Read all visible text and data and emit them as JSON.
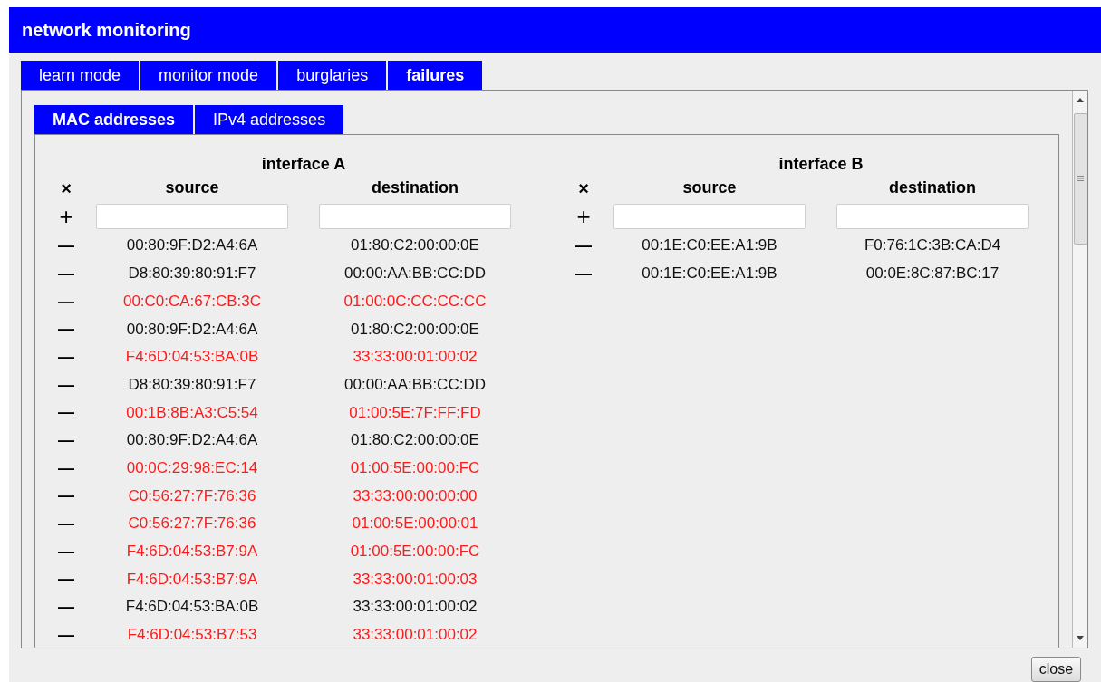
{
  "window": {
    "title": "network monitoring"
  },
  "tabs": [
    {
      "label": "learn mode",
      "selected": false
    },
    {
      "label": "monitor mode",
      "selected": false
    },
    {
      "label": "burglaries",
      "selected": false
    },
    {
      "label": "failures",
      "selected": true
    }
  ],
  "subtabs": [
    {
      "label": "MAC addresses",
      "selected": true
    },
    {
      "label": "IPv4 addresses",
      "selected": false
    }
  ],
  "interfaces": [
    {
      "title": "interface A",
      "clear": "×",
      "add": "+",
      "columns": [
        "source",
        "destination"
      ],
      "rows": [
        {
          "remove": "—",
          "source": "00:80:9F:D2:A4:6A",
          "destination": "01:80:C2:00:00:0E",
          "failed": false
        },
        {
          "remove": "—",
          "source": "D8:80:39:80:91:F7",
          "destination": "00:00:AA:BB:CC:DD",
          "failed": false
        },
        {
          "remove": "—",
          "source": "00:C0:CA:67:CB:3C",
          "destination": "01:00:0C:CC:CC:CC",
          "failed": true
        },
        {
          "remove": "—",
          "source": "00:80:9F:D2:A4:6A",
          "destination": "01:80:C2:00:00:0E",
          "failed": false
        },
        {
          "remove": "—",
          "source": "F4:6D:04:53:BA:0B",
          "destination": "33:33:00:01:00:02",
          "failed": true
        },
        {
          "remove": "—",
          "source": "D8:80:39:80:91:F7",
          "destination": "00:00:AA:BB:CC:DD",
          "failed": false
        },
        {
          "remove": "—",
          "source": "00:1B:8B:A3:C5:54",
          "destination": "01:00:5E:7F:FF:FD",
          "failed": true
        },
        {
          "remove": "—",
          "source": "00:80:9F:D2:A4:6A",
          "destination": "01:80:C2:00:00:0E",
          "failed": false
        },
        {
          "remove": "—",
          "source": "00:0C:29:98:EC:14",
          "destination": "01:00:5E:00:00:FC",
          "failed": true
        },
        {
          "remove": "—",
          "source": "C0:56:27:7F:76:36",
          "destination": "33:33:00:00:00:00",
          "failed": true
        },
        {
          "remove": "—",
          "source": "C0:56:27:7F:76:36",
          "destination": "01:00:5E:00:00:01",
          "failed": true
        },
        {
          "remove": "—",
          "source": "F4:6D:04:53:B7:9A",
          "destination": "01:00:5E:00:00:FC",
          "failed": true
        },
        {
          "remove": "—",
          "source": "F4:6D:04:53:B7:9A",
          "destination": "33:33:00:01:00:03",
          "failed": true
        },
        {
          "remove": "—",
          "source": "F4:6D:04:53:BA:0B",
          "destination": "33:33:00:01:00:02",
          "failed": false
        },
        {
          "remove": "—",
          "source": "F4:6D:04:53:B7:53",
          "destination": "33:33:00:01:00:02",
          "failed": true
        }
      ]
    },
    {
      "title": "interface B",
      "clear": "×",
      "add": "+",
      "columns": [
        "source",
        "destination"
      ],
      "rows": [
        {
          "remove": "—",
          "source": "00:1E:C0:EE:A1:9B",
          "destination": "F0:76:1C:3B:CA:D4",
          "failed": false
        },
        {
          "remove": "—",
          "source": "00:1E:C0:EE:A1:9B",
          "destination": "00:0E:8C:87:BC:17",
          "failed": false
        }
      ]
    }
  ],
  "close_button": "close"
}
